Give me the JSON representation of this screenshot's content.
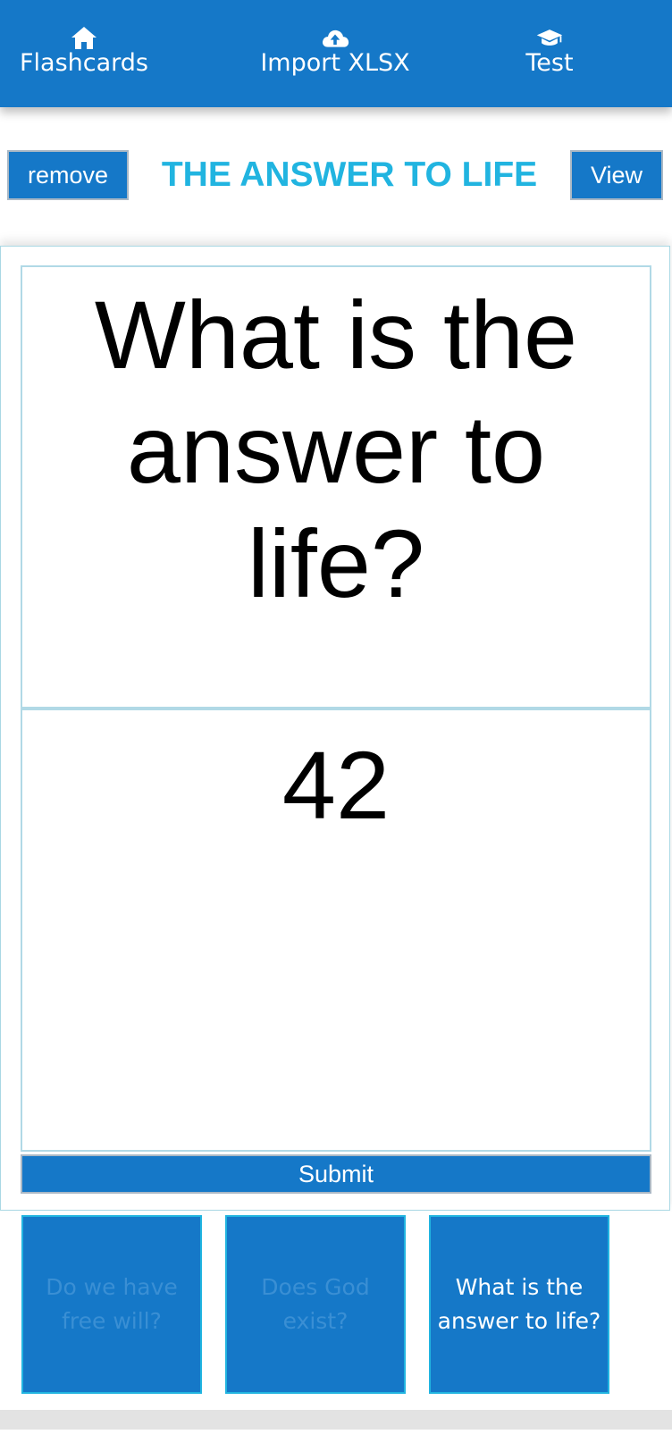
{
  "nav": {
    "items": [
      {
        "label": "Flashcards",
        "icon": "home-icon"
      },
      {
        "label": "Import XLSX",
        "icon": "cloud-upload-icon"
      },
      {
        "label": "Test",
        "icon": "graduation-cap-icon"
      }
    ]
  },
  "deck": {
    "title": "THE ANSWER TO LIFE",
    "remove_label": "remove",
    "view_label": "View"
  },
  "card": {
    "question": "What is the answer to life?",
    "answer": "42",
    "submit_label": "Submit"
  },
  "tiles": [
    {
      "label": "Do we have free will?",
      "state": "dim"
    },
    {
      "label": "Does God exist?",
      "state": "dim"
    },
    {
      "label": "What is the answer to life?",
      "state": "active"
    }
  ],
  "colors": {
    "primary": "#1578c8",
    "accent": "#21b4e0",
    "border": "#b1d9e6"
  }
}
